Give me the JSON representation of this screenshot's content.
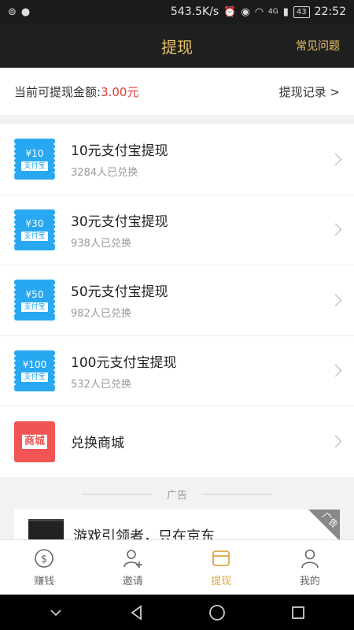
{
  "status_bar": {
    "speed": "543.5K/s",
    "network": "4G",
    "battery": "43",
    "time": "22:52"
  },
  "header": {
    "title": "提现",
    "faq_label": "常见问题"
  },
  "balance": {
    "label": "当前可提现金额:",
    "amount": "3.00元",
    "records_label": "提现记录 >"
  },
  "withdraw_options": [
    {
      "coupon_amount": "¥10",
      "coupon_tag": "支付宝",
      "title": "10元支付宝提现",
      "subtitle": "3284人已兑换"
    },
    {
      "coupon_amount": "¥30",
      "coupon_tag": "支付宝",
      "title": "30元支付宝提现",
      "subtitle": "938人已兑换"
    },
    {
      "coupon_amount": "¥50",
      "coupon_tag": "支付宝",
      "title": "50元支付宝提现",
      "subtitle": "982人已兑换"
    },
    {
      "coupon_amount": "¥100",
      "coupon_tag": "支付宝",
      "title": "100元支付宝提现",
      "subtitle": "532人已兑换"
    }
  ],
  "mall": {
    "icon_text": "商城",
    "title": "兑换商城"
  },
  "ad": {
    "divider_label": "广告",
    "corner_label": "广告",
    "text": "游戏引领者，只在京东"
  },
  "tabs": [
    {
      "label": "赚钱",
      "icon": "coin-icon"
    },
    {
      "label": "邀请",
      "icon": "add-user-icon"
    },
    {
      "label": "提现",
      "icon": "wallet-icon"
    },
    {
      "label": "我的",
      "icon": "person-icon"
    }
  ],
  "colors": {
    "accent": "#d9a74a",
    "header_gold": "#e8c46a",
    "coupon_blue": "#29a8f2",
    "mall_red": "#f05454",
    "amount_red": "#e53935"
  }
}
